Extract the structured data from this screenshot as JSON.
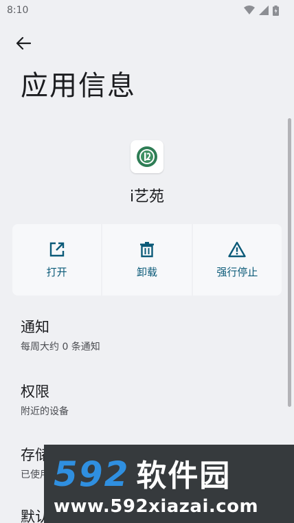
{
  "status_bar": {
    "time": "8:10"
  },
  "header": {
    "title": "应用信息"
  },
  "app": {
    "name": "i艺苑"
  },
  "actions": [
    {
      "label": "打开",
      "icon": "open-external-icon"
    },
    {
      "label": "卸载",
      "icon": "trash-icon"
    },
    {
      "label": "强行停止",
      "icon": "warning-icon"
    }
  ],
  "preferences": [
    {
      "title": "通知",
      "summary": "每周大约 0 条通知"
    },
    {
      "title": "权限",
      "summary": "附近的设备"
    },
    {
      "title": "存储",
      "summary": "已使用"
    },
    {
      "title": "默认",
      "summary": ""
    }
  ],
  "watermark": {
    "number": "592",
    "brand": "软件园",
    "url": "www.592xiazai.com"
  },
  "colors": {
    "background": "#eff0f3",
    "accent": "#0b5a78",
    "watermark_bg": "#363a3d",
    "watermark_blue": "#2f8fe0"
  }
}
